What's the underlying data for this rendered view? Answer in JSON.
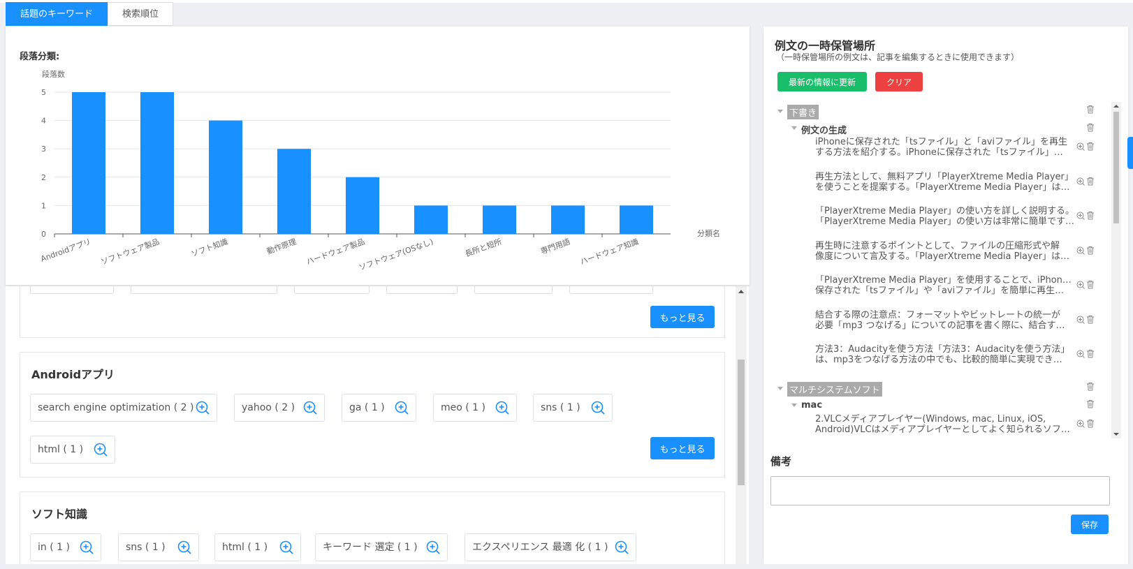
{
  "tabs": [
    {
      "label": "話題のキーワード",
      "active": true
    },
    {
      "label": "検索順位",
      "active": false
    }
  ],
  "chart_data": {
    "type": "bar",
    "title": "段落分類:",
    "ylabel": "段落数",
    "xlabel": "分類名",
    "ylim": [
      0,
      5
    ],
    "yticks": [
      "0",
      "1",
      "2",
      "3",
      "4",
      "5"
    ],
    "categories": [
      "Androidアプリ",
      "ソフトウェア製品",
      "ソフト知識",
      "動作原理",
      "ハードウェア製品",
      "ソフトウェア(OSなし)",
      "長所と短所",
      "専門用語",
      "ハードウェア知識"
    ],
    "values": [
      5,
      5,
      4,
      3,
      2,
      1,
      1,
      1,
      1
    ],
    "bar_color": "#1890ff",
    "grid": true
  },
  "sections": [
    {
      "title": "",
      "more_label": "もっと見る"
    },
    {
      "title": "Androidアプリ",
      "keywords": [
        "search engine optimization ( 2 )",
        "yahoo ( 2 )",
        "ga ( 1 )",
        "meo ( 1 )",
        "sns ( 1 )",
        "html ( 1 )"
      ],
      "more_label": "もっと見る"
    },
    {
      "title": "ソフト知識",
      "keywords": [
        "in ( 1 )",
        "sns ( 1 )",
        "html ( 1 )",
        "キーワード 選定 ( 1 )",
        "エクスペリエンス 最適 化 ( 1 )"
      ]
    }
  ],
  "right_panel": {
    "title": "例文の一時保管場所",
    "subtitle": "（一時保管場所の例文は、記事を編集するときに使用できます）",
    "update_label": "最新の情報に更新",
    "clear_label": "クリア",
    "folders": [
      {
        "label": "下書き",
        "subfolders": [
          {
            "label": "例文の生成",
            "items": [
              {
                "line1": "iPhoneに保存された「tsファイル」と「aviファイル」を再生",
                "line2": "する方法を紹介する。iPhoneに保存された「tsファイル」…"
              },
              {
                "line1": "再生方法として、無料アプリ「PlayerXtreme Media Player」",
                "line2": "を使うことを提案する。「PlayerXtreme Media Player」は…"
              },
              {
                "line1": "「PlayerXtreme Media Player」の使い方を詳しく説明する。",
                "line2": "「PlayerXtreme Media Player」の使い方は非常に簡単です…"
              },
              {
                "line1": "再生時に注意するポイントとして、ファイルの圧縮形式や解",
                "line2": "像度について言及する。「PlayerXtreme Media Player」は…"
              },
              {
                "line1": "「PlayerXtreme Media Player」を使用することで、iPhoneに",
                "line2": "保存された「tsファイル」や「aviファイル」を簡単に再生…"
              },
              {
                "line1": "結合する際の注意点：フォーマットやビットレートの統一が",
                "line2": "必要「mp3 つなげる」についての記事を書く際に、結合す…"
              },
              {
                "line1": "方法3：Audacityを使う方法「方法3：Audacityを使う方法」",
                "line2": "は、mp3をつなげる方法の中でも、比較的簡単に実現でき…"
              }
            ]
          }
        ]
      },
      {
        "label": "マルチシステムソフト",
        "subfolders": [
          {
            "label": "mac",
            "items": [
              {
                "line1": "2.VLCメディアプレイヤー(Windows, mac, Linux, iOS,",
                "line2": "Android)VLCはメディアプレイヤーとしてよく知られるソフ…"
              }
            ]
          }
        ]
      }
    ],
    "notes_label": "備考",
    "notes_value": "",
    "save_label": "保存"
  }
}
